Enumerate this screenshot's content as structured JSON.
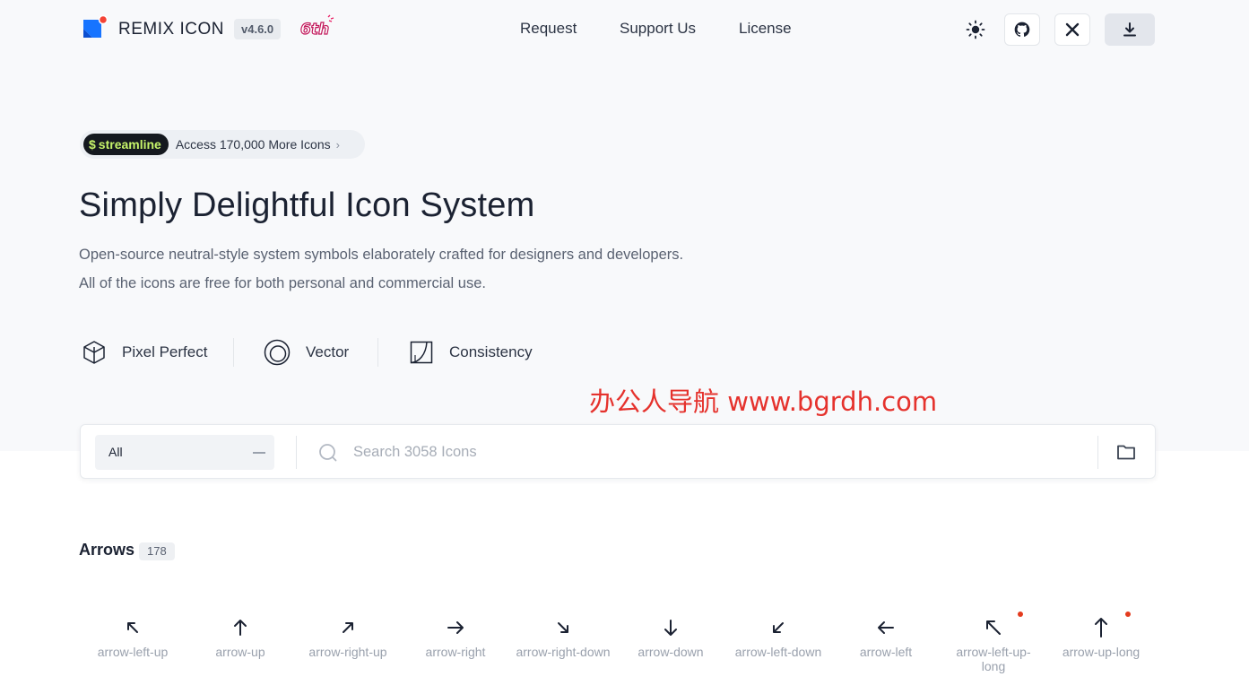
{
  "header": {
    "brand": "REMIX ICON",
    "version": "v4.6.0",
    "anniversary": "6th",
    "nav": [
      "Request",
      "Support Us",
      "License"
    ],
    "buttons": {
      "theme_icon": "sun-icon",
      "github_icon": "github-icon",
      "x_label": "𝕏",
      "download_icon": "download-icon"
    }
  },
  "promo": {
    "badge": "streamline",
    "text": "Access 170,000 More Icons",
    "chevron": "›"
  },
  "hero": {
    "title": "Simply Delightful Icon System",
    "desc1": "Open-source neutral-style system symbols elaborately crafted for designers and developers.",
    "desc2": "All of the icons are free for both personal and commercial use."
  },
  "features": [
    {
      "label": "Pixel Perfect",
      "icon": "cube-icon"
    },
    {
      "label": "Vector",
      "icon": "vector-circle-icon"
    },
    {
      "label": "Consistency",
      "icon": "consistency-icon"
    }
  ],
  "watermark": "办公人导航  www.bgrdh.com",
  "search": {
    "category": "All",
    "placeholder": "Search 3058 Icons"
  },
  "category": {
    "title": "Arrows",
    "count": "178"
  },
  "icons": [
    {
      "name": "arrow-left-up",
      "new": false
    },
    {
      "name": "arrow-up",
      "new": false
    },
    {
      "name": "arrow-right-up",
      "new": false
    },
    {
      "name": "arrow-right",
      "new": false
    },
    {
      "name": "arrow-right-down",
      "new": false
    },
    {
      "name": "arrow-down",
      "new": false
    },
    {
      "name": "arrow-left-down",
      "new": false
    },
    {
      "name": "arrow-left",
      "new": false
    },
    {
      "name": "arrow-left-up-long",
      "new": true
    },
    {
      "name": "arrow-up-long",
      "new": true
    }
  ],
  "colors": {
    "accent": "#1774ff",
    "new_dot": "#e43b1e",
    "watermark": "#e5322d"
  }
}
